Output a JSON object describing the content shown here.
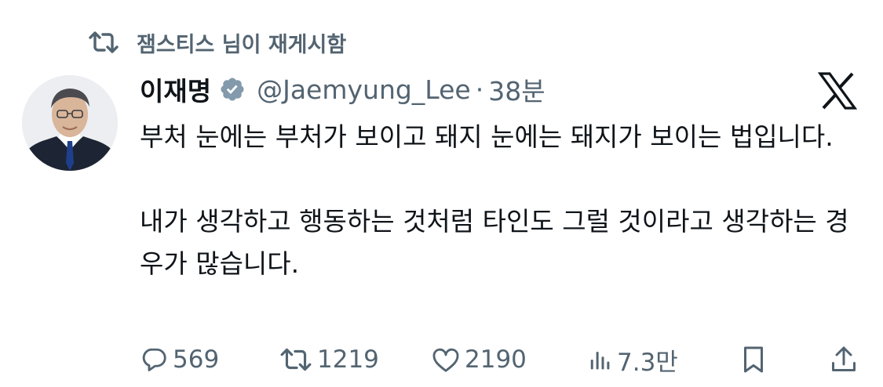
{
  "retweet_context": {
    "icon": "retweet-icon",
    "text": "잼스티스 님이 재게시함"
  },
  "author": {
    "display_name": "이재명",
    "verified_icon": "verified-badge-icon",
    "handle": "@Jaemyung_Lee",
    "separator": "·",
    "time": "38분"
  },
  "platform_logo": "x-logo-icon",
  "tweet": {
    "paragraph1": "부처 눈에는 부처가 보이고 돼지 눈에는 돼지가 보이는 법입니다.",
    "paragraph2": "내가 생각하고 행동하는 것처럼 타인도 그럴 것이라고 생각하는 경우가 많습니다."
  },
  "actions": {
    "replies": {
      "icon": "reply-icon",
      "count": "569"
    },
    "reposts": {
      "icon": "retweet-icon",
      "count": "1219"
    },
    "likes": {
      "icon": "heart-icon",
      "count": "2190"
    },
    "views": {
      "icon": "views-icon",
      "count": "7.3만"
    },
    "bookmark": {
      "icon": "bookmark-icon"
    },
    "share": {
      "icon": "share-icon"
    }
  },
  "colors": {
    "text_primary": "#0f1419",
    "text_secondary": "#536471",
    "verified_badge": "#829aab"
  }
}
